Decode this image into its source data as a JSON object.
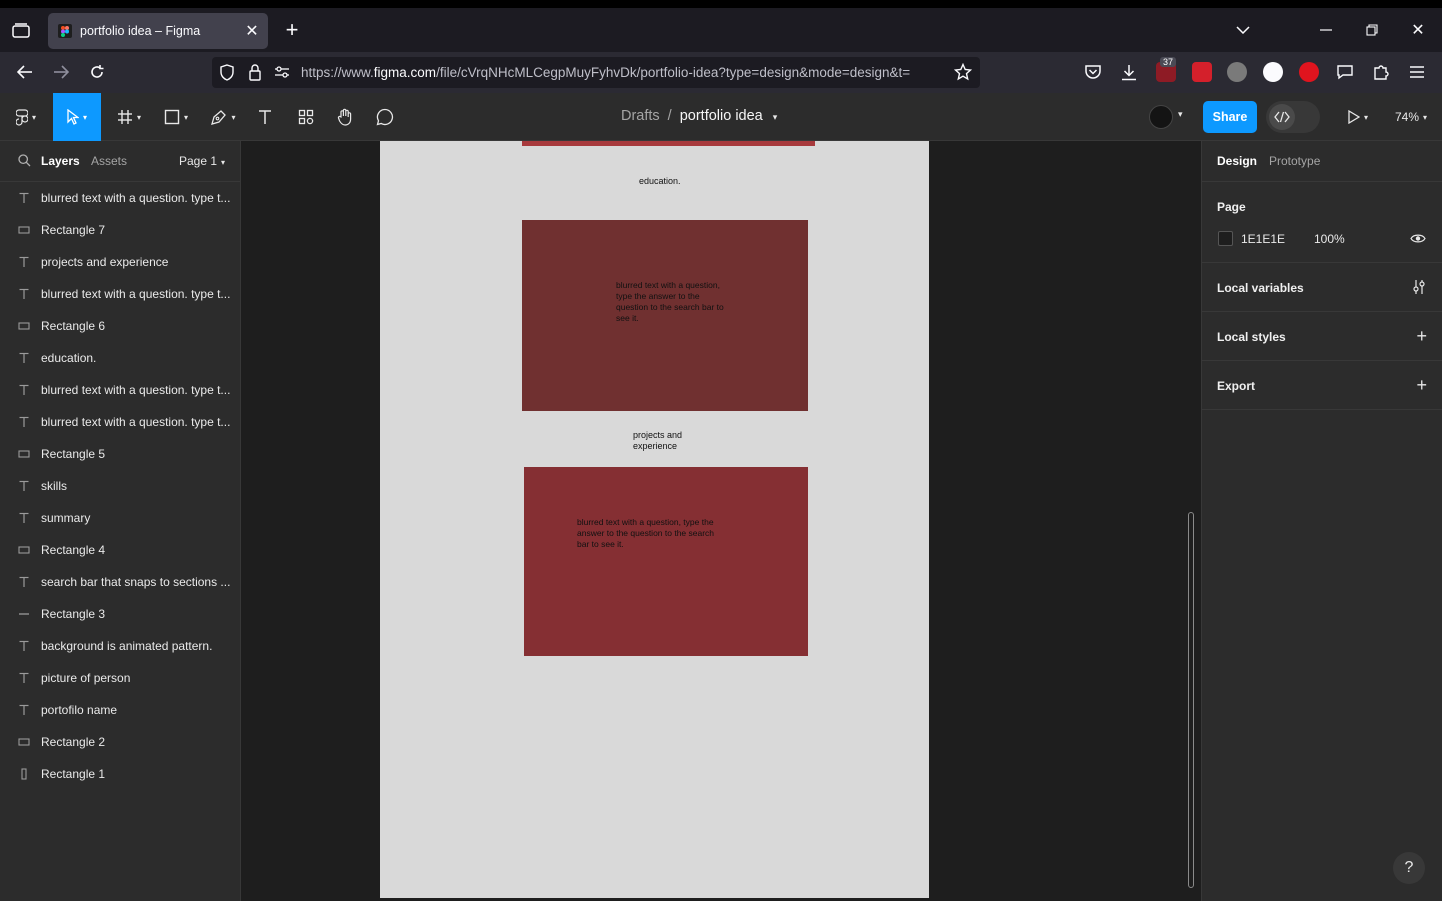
{
  "browser": {
    "tab_title": "portfolio idea – Figma",
    "url_prefix": "https://www.",
    "url_domain": "figma.com",
    "url_rest": "/file/cVrqNHcMLCegpMuyFyhvDk/portfolio-idea?type=design&mode=design&t=",
    "extension_badge": "37"
  },
  "toolbar": {
    "breadcrumb_drafts": "Drafts",
    "breadcrumb_sep": "/",
    "file_name": "portfolio idea",
    "share_label": "Share",
    "zoom": "74%"
  },
  "left_panel": {
    "tab_layers": "Layers",
    "tab_assets": "Assets",
    "page_selector": "Page 1",
    "layers": [
      {
        "type": "text",
        "name": "blurred text with a question. type t..."
      },
      {
        "type": "rect",
        "name": "Rectangle 7"
      },
      {
        "type": "text",
        "name": "projects and experience"
      },
      {
        "type": "text",
        "name": "blurred text with a question. type t..."
      },
      {
        "type": "rect",
        "name": "Rectangle 6"
      },
      {
        "type": "text",
        "name": "education."
      },
      {
        "type": "text",
        "name": "blurred text with a question. type t..."
      },
      {
        "type": "text",
        "name": "blurred text with a question. type t..."
      },
      {
        "type": "rect",
        "name": "Rectangle 5"
      },
      {
        "type": "text",
        "name": "skills"
      },
      {
        "type": "text",
        "name": "summary"
      },
      {
        "type": "rect",
        "name": "Rectangle 4"
      },
      {
        "type": "text",
        "name": "search bar that snaps to sections ..."
      },
      {
        "type": "line",
        "name": "Rectangle 3"
      },
      {
        "type": "text",
        "name": "background is animated pattern."
      },
      {
        "type": "text",
        "name": "picture of person"
      },
      {
        "type": "text",
        "name": "portofilo name"
      },
      {
        "type": "rect",
        "name": "Rectangle 2"
      },
      {
        "type": "vrect",
        "name": "Rectangle 1"
      }
    ]
  },
  "canvas": {
    "heading_education": "education.",
    "box1_text": "blurred text with a question, type the answer to the question to the search bar to see it.",
    "heading_projects": "projects and experience",
    "box2_text": "blurred text with a question, type the answer to the question to the search bar to see it.",
    "frame_color": "#d9d9d9",
    "box1_color": "#703030",
    "box2_color": "#852f33",
    "top_strip_color": "#a83a3d"
  },
  "right_panel": {
    "tab_design": "Design",
    "tab_prototype": "Prototype",
    "page_section_title": "Page",
    "page_color_hex": "1E1E1E",
    "page_opacity": "100%",
    "local_variables": "Local variables",
    "local_styles": "Local styles",
    "export": "Export"
  },
  "help_label": "?"
}
